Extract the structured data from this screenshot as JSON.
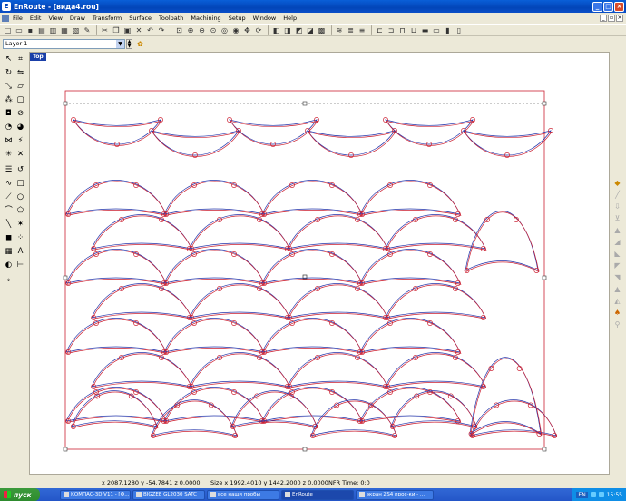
{
  "window": {
    "app_name": "EnRoute",
    "title": "EnRoute - [вида4.rou]"
  },
  "menu": [
    "File",
    "Edit",
    "View",
    "Draw",
    "Transform",
    "Surface",
    "Toolpath",
    "Machining",
    "Setup",
    "Window",
    "Help"
  ],
  "toolbar2": {
    "layer_value": "Layer 1"
  },
  "canvas": {
    "view_label": "Top"
  },
  "status": {
    "coords": "x 2087.1280 y -54.7841 z 0.0000",
    "size": "Size x 1992.4010 y 1442.2000 z 0.0000",
    "nfr": "NFR Time: 0:0"
  },
  "taskbar": {
    "start_label": "пуск",
    "tasks": [
      "КОМПАС-3D V11 - [Ф...",
      "BIGZEE GL2030 SATC",
      "все наши пробы",
      "EnRoute",
      "экран ZS4 прос-ки - ..."
    ],
    "lang": "EN",
    "clock": "15:55"
  },
  "colors": {
    "title_blue": "#0245b8",
    "toolpath_blue": "#2233aa",
    "toolpath_red": "#cc2233",
    "bbox_red": "#cc2233"
  }
}
